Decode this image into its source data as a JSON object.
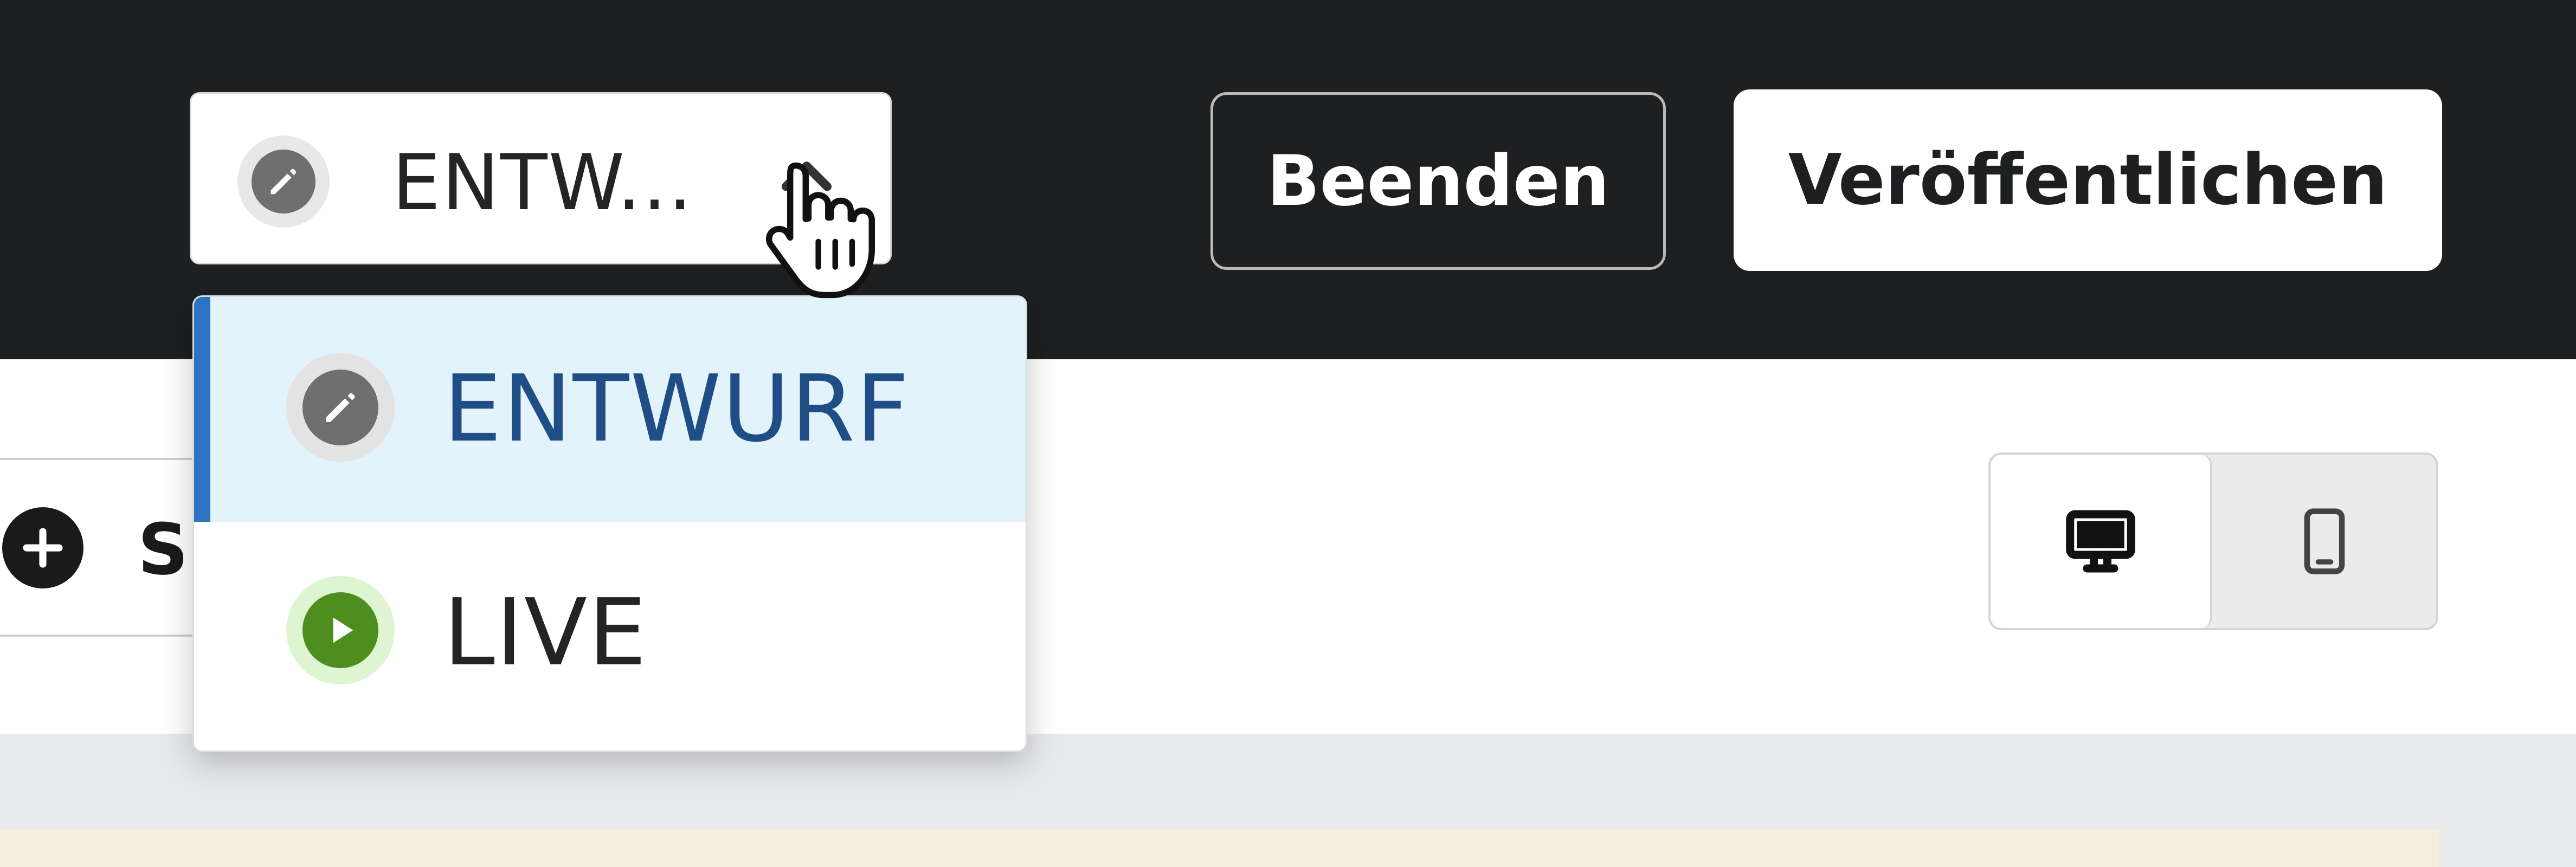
{
  "status": {
    "current_label": "ENTW...",
    "options": [
      {
        "label": "ENTWURF",
        "icon": "pencil-icon",
        "selected": true
      },
      {
        "label": "LIVE",
        "icon": "play-icon",
        "selected": false
      }
    ]
  },
  "actions": {
    "quit_label": "Beenden",
    "publish_label": "Veröffentlichen"
  },
  "toolbar": {
    "add_button_label": "S"
  },
  "device_toggle": {
    "options": [
      "desktop-icon",
      "mobile-icon"
    ],
    "active": "desktop"
  },
  "colors": {
    "topbar_bg": "#1e1f21",
    "selected_bg": "#e2f3fb",
    "selected_accent": "#2d74c2",
    "selected_text": "#1f4e86",
    "live_green": "#4e8e1e"
  }
}
